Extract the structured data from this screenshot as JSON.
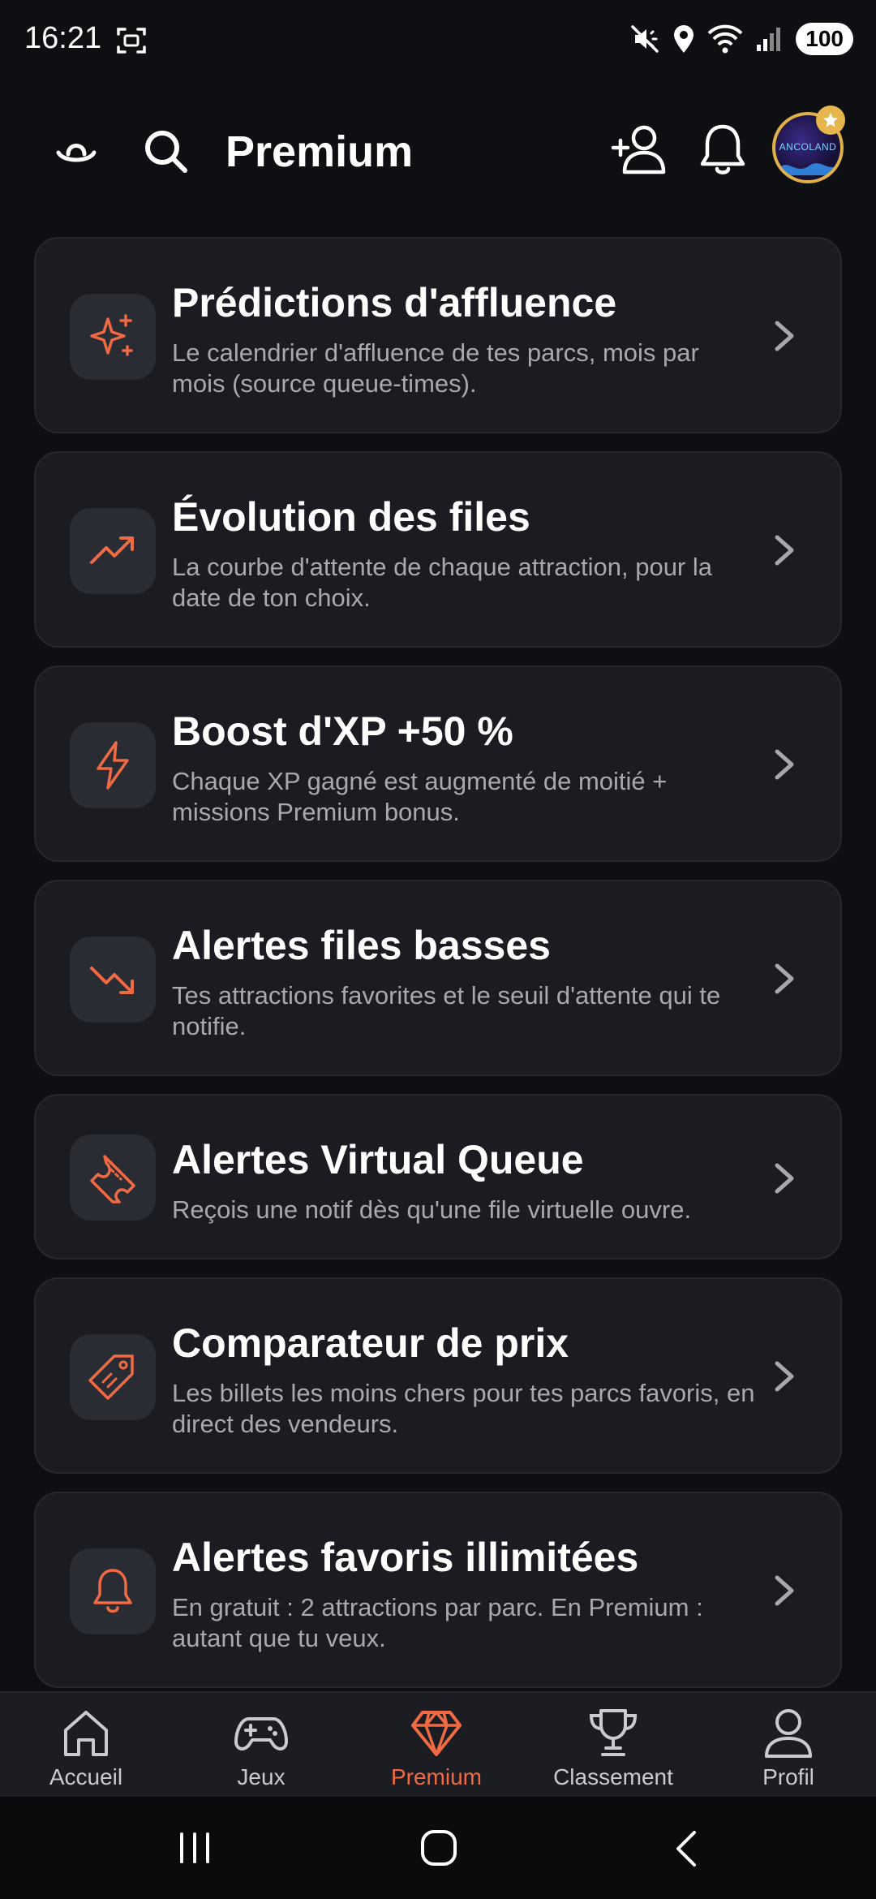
{
  "status_bar": {
    "time": "16:21",
    "battery": "100",
    "icons": [
      "screenshot-icon",
      "mute-vibrate-icon",
      "location-icon",
      "wifi-icon",
      "signal-icon"
    ]
  },
  "header": {
    "title": "Premium",
    "icons": [
      "app-logo-icon",
      "search-icon",
      "add-user-icon",
      "bell-icon",
      "avatar"
    ],
    "avatar_text": "ANCOLAND"
  },
  "accent_color": "#f06a44",
  "cards": [
    {
      "title": "Prédictions d'affluence",
      "description": "Le calendrier d'affluence de tes parcs, mois par mois (source queue-times).",
      "icon": "sparkles-icon"
    },
    {
      "title": "Évolution des files",
      "description": "La courbe d'attente de chaque attraction, pour la date de ton choix.",
      "icon": "trending-up-icon"
    },
    {
      "title": "Boost d'XP +50 %",
      "description": "Chaque XP gagné est augmenté de moitié + missions Premium bonus.",
      "icon": "lightning-icon"
    },
    {
      "title": "Alertes files basses",
      "description": "Tes attractions favorites et le seuil d'attente qui te notifie.",
      "icon": "trending-down-icon"
    },
    {
      "title": "Alertes Virtual Queue",
      "description": "Reçois une notif dès qu'une file virtuelle ouvre.",
      "icon": "ticket-icon"
    },
    {
      "title": "Comparateur de prix",
      "description": "Les billets les moins chers pour tes parcs favoris, en direct des vendeurs.",
      "icon": "price-tag-icon"
    },
    {
      "title": "Alertes favoris illimitées",
      "description": "En gratuit : 2 attractions par parc. En Premium : autant que tu veux.",
      "icon": "bell-icon"
    }
  ],
  "bottom_nav": [
    {
      "label": "Accueil",
      "icon": "home-icon",
      "active": false
    },
    {
      "label": "Jeux",
      "icon": "gamepad-icon",
      "active": false
    },
    {
      "label": "Premium",
      "icon": "diamond-icon",
      "active": true
    },
    {
      "label": "Classement",
      "icon": "trophy-icon",
      "active": false
    },
    {
      "label": "Profil",
      "icon": "user-icon",
      "active": false
    }
  ],
  "system_nav": [
    "recent-apps-button",
    "home-button",
    "back-button"
  ]
}
